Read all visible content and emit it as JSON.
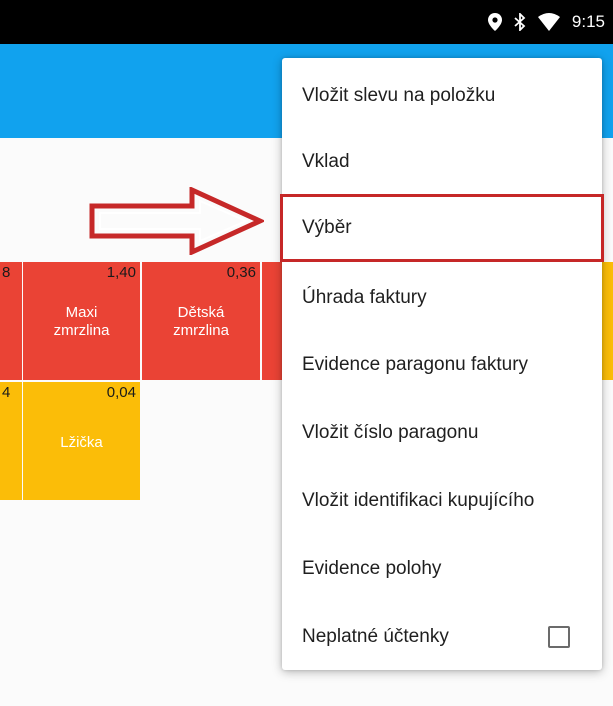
{
  "status_bar": {
    "time": "9:15",
    "icons": [
      "location-icon",
      "bluetooth-icon",
      "wifi-icon"
    ]
  },
  "app_bar": {
    "color": "#11a2ee"
  },
  "tiles": [
    {
      "price": "8",
      "name": "",
      "color": "#ea4335"
    },
    {
      "price": "1,40",
      "name": "Maxi zmrzlina",
      "color": "#ea4335"
    },
    {
      "price": "0,36",
      "name": "Dětská zmrzlina",
      "color": "#ea4335"
    },
    {
      "price": "4",
      "name": "",
      "color": "#fbbd08"
    },
    {
      "price": "0,04",
      "name": "Lžička",
      "color": "#fbbd08"
    }
  ],
  "menu": {
    "items": [
      {
        "label": "Vložit slevu na položku"
      },
      {
        "label": "Vklad"
      },
      {
        "label": "Výběr",
        "highlighted": true
      },
      {
        "label": "Úhrada faktury"
      },
      {
        "label": "Evidence paragonu faktury"
      },
      {
        "label": "Vložit číslo paragonu"
      },
      {
        "label": "Vložit identifikaci kupujícího"
      },
      {
        "label": "Evidence polohy"
      },
      {
        "label": "Neplatné účtenky",
        "checkbox": true,
        "checked": false
      }
    ]
  },
  "annotation": {
    "highlight_color": "#c62828"
  }
}
